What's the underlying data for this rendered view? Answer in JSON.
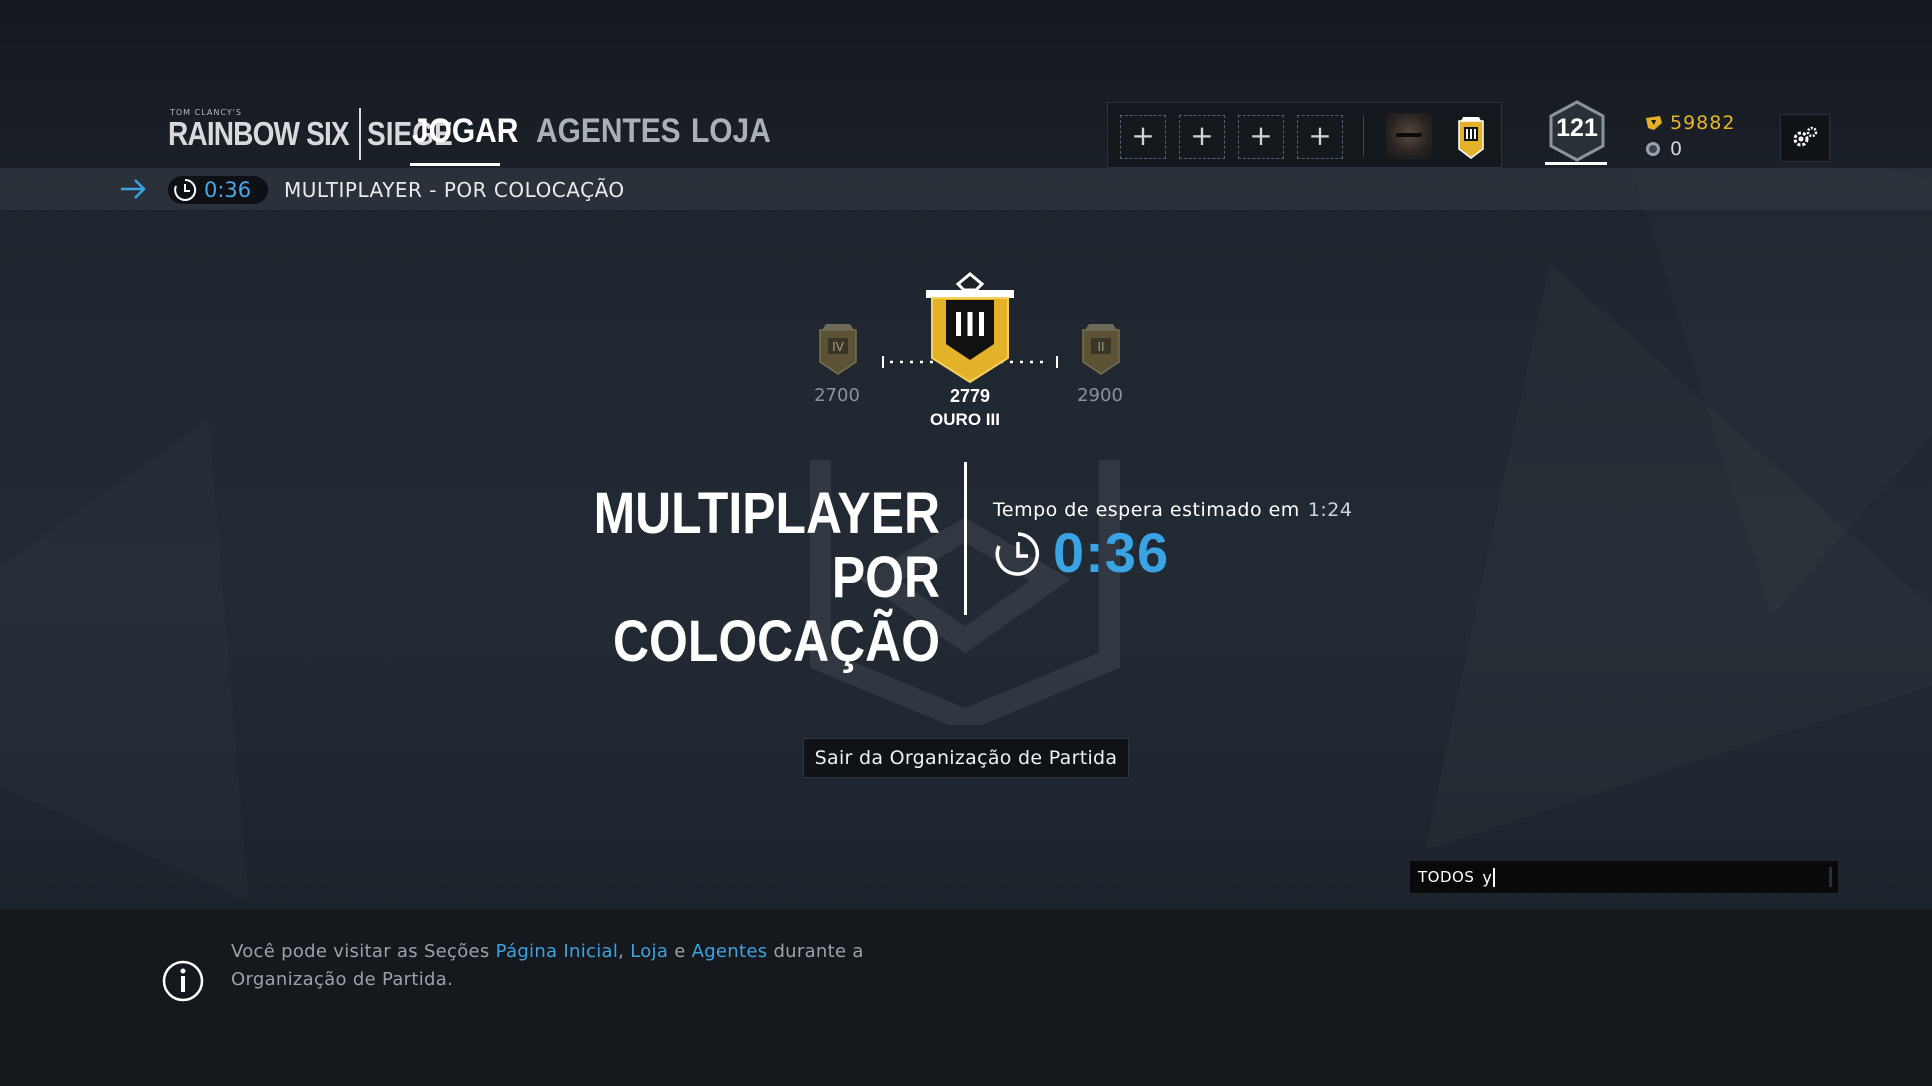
{
  "header": {
    "logo": {
      "tagline": "TOM CLANCY'S",
      "word1": "RAINBOW SIX",
      "word2": "SIEGE"
    },
    "nav": [
      {
        "label": "JOGAR",
        "active": true
      },
      {
        "label": "AGENTES",
        "active": false
      },
      {
        "label": "LOJA",
        "active": false
      }
    ],
    "squad": {
      "slots": [
        "+",
        "+",
        "+",
        "+"
      ],
      "avatar": "player-avatar",
      "mini_rank": "gold-III"
    },
    "level": "121",
    "renown": "59882",
    "credits": "0",
    "settings_icon": "gear-icon"
  },
  "subbar": {
    "timer": "0:36",
    "title": "MULTIPLAYER - POR COLOCAÇÃO"
  },
  "rank": {
    "prev": {
      "numeral": "IV",
      "value": "2700"
    },
    "current": {
      "numeral": "III",
      "value": "2779",
      "name": "OURO III"
    },
    "next": {
      "numeral": "II",
      "value": "2900"
    },
    "color": "#e3b229"
  },
  "match": {
    "title_line1": "MULTIPLAYER",
    "title_line2": "POR  COLOCAÇÃO",
    "wait_label": "Tempo de espera estimado em",
    "wait_estimate": "1:24",
    "timer": "0:36",
    "timer_color": "#3aa3e3",
    "leave_button": "Sair da Organização de Partida"
  },
  "chat": {
    "scope": "TODOS",
    "text": "y"
  },
  "footer": {
    "tip_part1": "Você pode visitar as Seções ",
    "link1": "Página Inicial",
    "tip_sep1": ", ",
    "link2": "Loja",
    "tip_sep2": " e ",
    "link3": "Agentes",
    "tip_part2": " durante a Organização de Partida."
  }
}
